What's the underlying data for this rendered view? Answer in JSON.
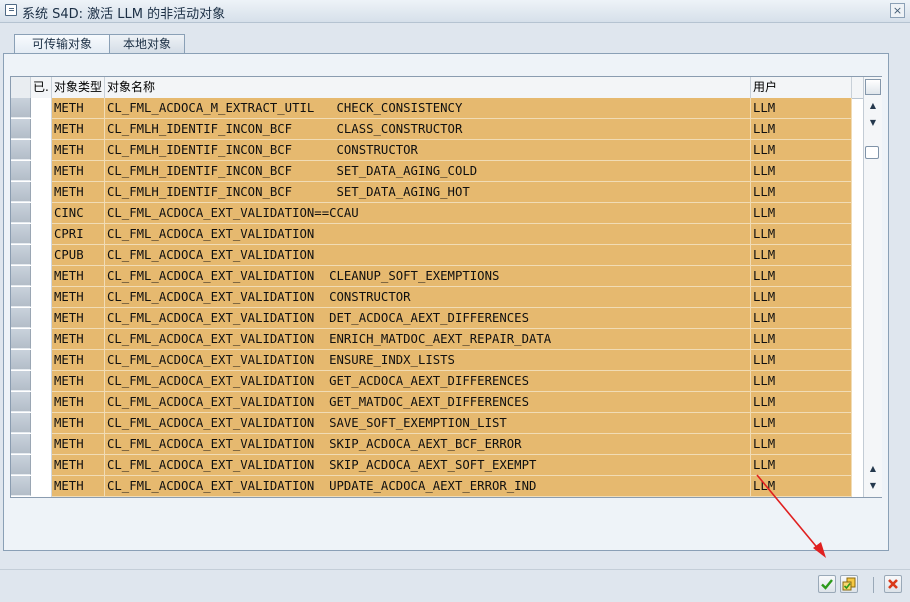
{
  "window": {
    "title": "系统 S4D: 激活 LLM 的非活动对象",
    "close_label": "×"
  },
  "tabs": [
    {
      "label": "可传输对象",
      "active": true
    },
    {
      "label": "本地对象",
      "active": false
    }
  ],
  "table": {
    "headers": {
      "check": "已.",
      "type": "对象类型",
      "name": "对象名称",
      "user": "用户"
    },
    "rows": [
      {
        "type": "METH",
        "name": "CL_FML_ACDOCA_M_EXTRACT_UTIL   CHECK_CONSISTENCY",
        "user": "LLM"
      },
      {
        "type": "METH",
        "name": "CL_FMLH_IDENTIF_INCON_BCF      CLASS_CONSTRUCTOR",
        "user": "LLM"
      },
      {
        "type": "METH",
        "name": "CL_FMLH_IDENTIF_INCON_BCF      CONSTRUCTOR",
        "user": "LLM"
      },
      {
        "type": "METH",
        "name": "CL_FMLH_IDENTIF_INCON_BCF      SET_DATA_AGING_COLD",
        "user": "LLM"
      },
      {
        "type": "METH",
        "name": "CL_FMLH_IDENTIF_INCON_BCF      SET_DATA_AGING_HOT",
        "user": "LLM"
      },
      {
        "type": "CINC",
        "name": "CL_FML_ACDOCA_EXT_VALIDATION==CCAU",
        "user": "LLM"
      },
      {
        "type": "CPRI",
        "name": "CL_FML_ACDOCA_EXT_VALIDATION",
        "user": "LLM"
      },
      {
        "type": "CPUB",
        "name": "CL_FML_ACDOCA_EXT_VALIDATION",
        "user": "LLM"
      },
      {
        "type": "METH",
        "name": "CL_FML_ACDOCA_EXT_VALIDATION  CLEANUP_SOFT_EXEMPTIONS",
        "user": "LLM"
      },
      {
        "type": "METH",
        "name": "CL_FML_ACDOCA_EXT_VALIDATION  CONSTRUCTOR",
        "user": "LLM"
      },
      {
        "type": "METH",
        "name": "CL_FML_ACDOCA_EXT_VALIDATION  DET_ACDOCA_AEXT_DIFFERENCES",
        "user": "LLM"
      },
      {
        "type": "METH",
        "name": "CL_FML_ACDOCA_EXT_VALIDATION  ENRICH_MATDOC_AEXT_REPAIR_DATA",
        "user": "LLM"
      },
      {
        "type": "METH",
        "name": "CL_FML_ACDOCA_EXT_VALIDATION  ENSURE_INDX_LISTS",
        "user": "LLM"
      },
      {
        "type": "METH",
        "name": "CL_FML_ACDOCA_EXT_VALIDATION  GET_ACDOCA_AEXT_DIFFERENCES",
        "user": "LLM"
      },
      {
        "type": "METH",
        "name": "CL_FML_ACDOCA_EXT_VALIDATION  GET_MATDOC_AEXT_DIFFERENCES",
        "user": "LLM"
      },
      {
        "type": "METH",
        "name": "CL_FML_ACDOCA_EXT_VALIDATION  SAVE_SOFT_EXEMPTION_LIST",
        "user": "LLM"
      },
      {
        "type": "METH",
        "name": "CL_FML_ACDOCA_EXT_VALIDATION  SKIP_ACDOCA_AEXT_BCF_ERROR",
        "user": "LLM"
      },
      {
        "type": "METH",
        "name": "CL_FML_ACDOCA_EXT_VALIDATION  SKIP_ACDOCA_AEXT_SOFT_EXEMPT",
        "user": "LLM"
      },
      {
        "type": "METH",
        "name": "CL_FML_ACDOCA_EXT_VALIDATION  UPDATE_ACDOCA_AEXT_ERROR_IND",
        "user": "LLM"
      }
    ]
  },
  "scrollbar": {
    "up": "▲",
    "down": "▼"
  },
  "buttons": {
    "confirm_icon": "checkmark-icon",
    "activate_icon": "activate-icon",
    "cancel_icon": "cancel-icon"
  },
  "colors": {
    "row_highlight": "#e6b96f",
    "confirm": "#2d9a1b",
    "cancel": "#d93a1a",
    "annotation_arrow": "#e02020"
  }
}
